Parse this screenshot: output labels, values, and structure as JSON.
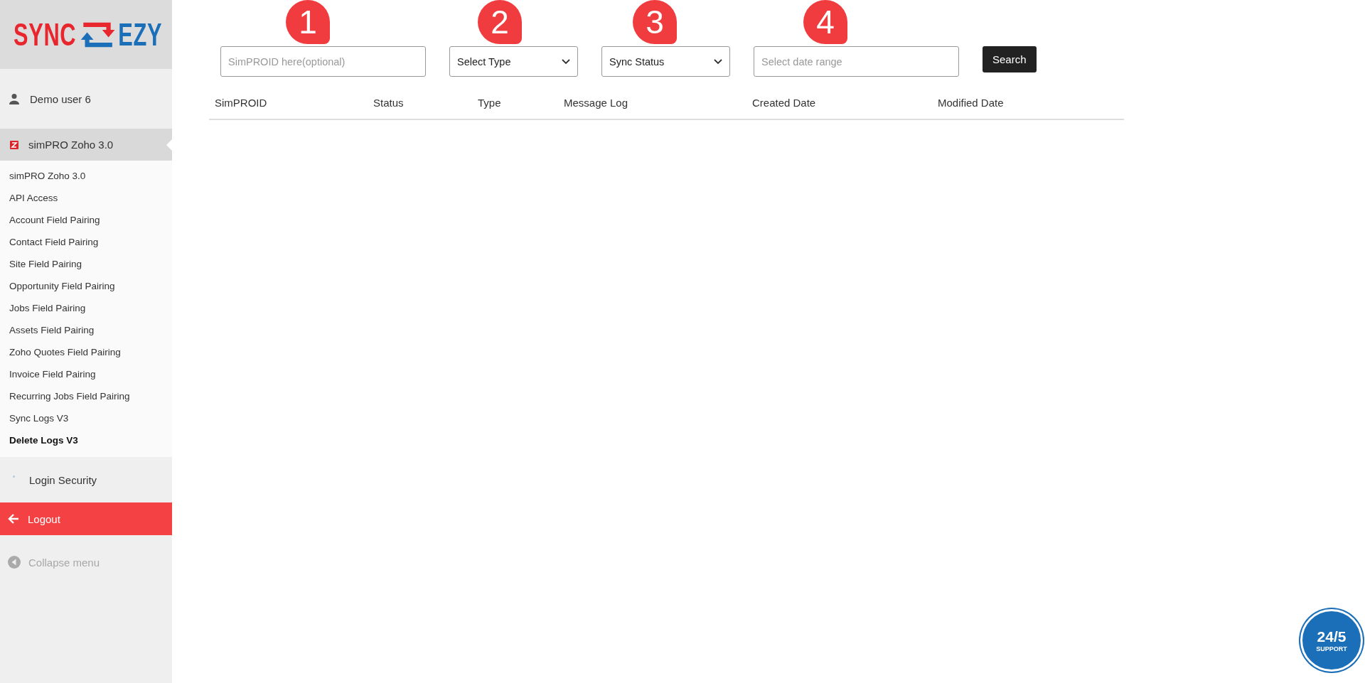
{
  "logo": {
    "left": "SYNC",
    "right": "EZY"
  },
  "sidebar": {
    "user": "Demo user 6",
    "section": {
      "label": "simPRO Zoho 3.0",
      "expanded": true
    },
    "items": [
      {
        "label": "simPRO Zoho 3.0",
        "selected": false
      },
      {
        "label": "API Access",
        "selected": false
      },
      {
        "label": "Account Field Pairing",
        "selected": false
      },
      {
        "label": "Contact Field Pairing",
        "selected": false
      },
      {
        "label": "Site Field Pairing",
        "selected": false
      },
      {
        "label": "Opportunity Field Pairing",
        "selected": false
      },
      {
        "label": "Jobs Field Pairing",
        "selected": false
      },
      {
        "label": "Assets Field Pairing",
        "selected": false
      },
      {
        "label": "Zoho Quotes Field Pairing",
        "selected": false
      },
      {
        "label": "Invoice Field Pairing",
        "selected": false
      },
      {
        "label": "Recurring Jobs Field Pairing",
        "selected": false
      },
      {
        "label": "Sync Logs V3",
        "selected": false
      },
      {
        "label": "Delete Logs V3",
        "selected": true
      }
    ],
    "login_security": "Login Security",
    "logout": "Logout",
    "collapse": "Collapse menu"
  },
  "filters": [
    {
      "kind": "input",
      "placeholder": "SimPROID here(optional)",
      "marker": "1"
    },
    {
      "kind": "select",
      "value": "Select Type",
      "marker": "2"
    },
    {
      "kind": "select",
      "value": "Sync Status",
      "marker": "3"
    },
    {
      "kind": "input",
      "placeholder": "Select date range",
      "marker": "4"
    }
  ],
  "search_button": "Search",
  "table": {
    "columns": [
      "SimPROID",
      "Status",
      "Type",
      "Message Log",
      "Created Date",
      "Modified Date"
    ]
  },
  "support_badge": {
    "top": "24/5",
    "bottom": "SUPPORT"
  }
}
